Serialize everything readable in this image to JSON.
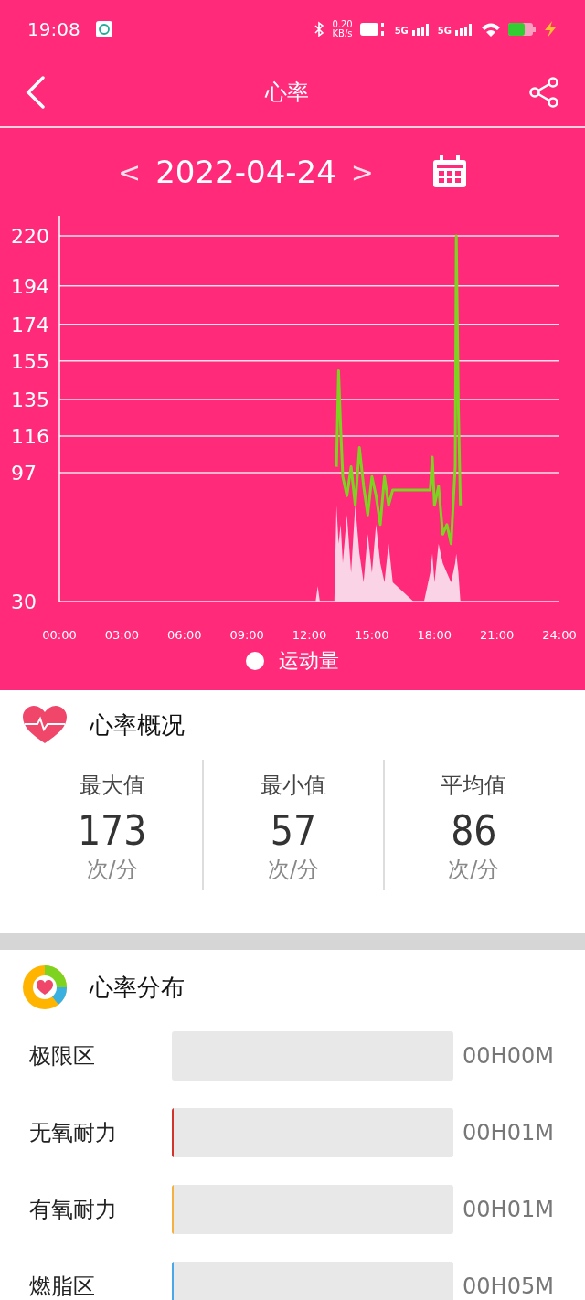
{
  "status_bar": {
    "time": "19:08",
    "speed": "0.20",
    "speed_unit": "KB/s",
    "sim_1": "5G",
    "sim_2": "5G"
  },
  "header": {
    "title": "心率"
  },
  "date_nav": {
    "prev": "<",
    "date": "2022-04-24",
    "next": ">"
  },
  "chart": {
    "chart_data": {
      "type": "line",
      "grid": true,
      "xlim": [
        0,
        24
      ],
      "ylim": [
        30,
        220
      ],
      "yticks": [
        30,
        97,
        116,
        135,
        155,
        174,
        194,
        220
      ],
      "xticks": [
        {
          "value": 0,
          "label": "00:00"
        },
        {
          "value": 3,
          "label": "03:00"
        },
        {
          "value": 6,
          "label": "06:00"
        },
        {
          "value": 9,
          "label": "09:00"
        },
        {
          "value": 12,
          "label": "12:00"
        },
        {
          "value": 15,
          "label": "15:00"
        },
        {
          "value": 18,
          "label": "18:00"
        },
        {
          "value": 21,
          "label": "21:00"
        },
        {
          "value": 24,
          "label": "24:00"
        }
      ],
      "x": [
        0,
        12.3,
        12.4,
        12.5,
        13.2,
        13.3,
        13.4,
        13.5,
        13.6,
        13.8,
        14.0,
        14.2,
        14.4,
        14.6,
        14.8,
        15.0,
        15.2,
        15.4,
        15.6,
        15.8,
        16.0,
        16.5,
        17.0,
        17.3,
        17.5,
        17.8,
        17.9,
        18.0,
        18.2,
        18.4,
        18.6,
        18.8,
        19.0,
        19.05,
        19.15,
        19.25,
        24
      ],
      "series": [
        {
          "color": "#7ed321",
          "values": [
            null,
            null,
            null,
            null,
            null,
            100,
            150,
            120,
            95,
            85,
            100,
            80,
            110,
            90,
            75,
            95,
            85,
            70,
            95,
            80,
            88,
            88,
            88,
            88,
            88,
            88,
            105,
            80,
            90,
            65,
            70,
            60,
            100,
            220,
            130,
            80,
            null
          ]
        },
        {
          "name": "运动量",
          "type": "area",
          "color": "#fbd3e6",
          "values": [
            30,
            30,
            38,
            30,
            30,
            80,
            60,
            70,
            50,
            75,
            45,
            80,
            55,
            40,
            65,
            45,
            70,
            50,
            40,
            60,
            40,
            35,
            30,
            30,
            30,
            45,
            55,
            40,
            60,
            50,
            45,
            40,
            50,
            55,
            45,
            30,
            30
          ]
        }
      ]
    }
  },
  "summary": {
    "title": "心率概况",
    "stats": [
      {
        "label": "最大值",
        "value": "173",
        "unit": "次/分"
      },
      {
        "label": "最小值",
        "value": "57",
        "unit": "次/分"
      },
      {
        "label": "平均值",
        "value": "86",
        "unit": "次/分"
      }
    ]
  },
  "distribution": {
    "title": "心率分布",
    "zones": [
      {
        "name": "极限区",
        "time": "00H00M"
      },
      {
        "name": "无氧耐力",
        "level": 0.005,
        "color": "#d0342c",
        "time": "00H01M"
      },
      {
        "name": "有氧耐力",
        "level": 0.005,
        "color": "#f5b041",
        "time": "00H01M"
      },
      {
        "name": "燃脂区",
        "level": 0.008,
        "color": "#4aa8e8",
        "time": "00H05M"
      }
    ]
  }
}
